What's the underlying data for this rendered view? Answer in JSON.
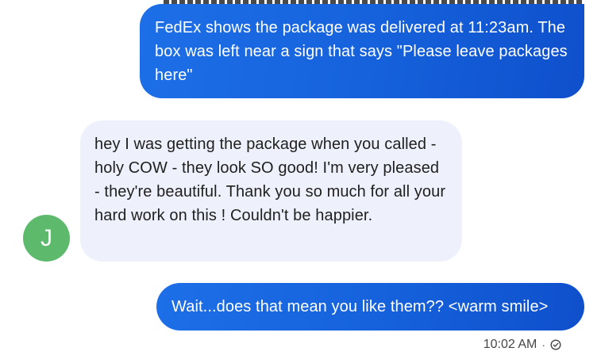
{
  "conversation": {
    "messages": [
      {
        "direction": "outgoing",
        "text": "FedEx shows the package was delivered at 11:23am. The box was left near a sign that says \"Please leave packages here\""
      },
      {
        "direction": "incoming",
        "sender_initial": "J",
        "text": "hey I was getting the package when you called - holy COW - they look SO good! I'm very pleased - they're beautiful. Thank you so much for all your hard work on this ! Couldn't be happier."
      },
      {
        "direction": "outgoing",
        "text": "Wait...does that mean you like them?? <warm smile>"
      }
    ],
    "last_message_time": "10:02 AM",
    "separator": "·",
    "status_icon": "check-circle-icon"
  },
  "colors": {
    "outgoing_bubble": "#1a66e3",
    "incoming_bubble": "#eef1fb",
    "avatar": "#5dba6d"
  }
}
